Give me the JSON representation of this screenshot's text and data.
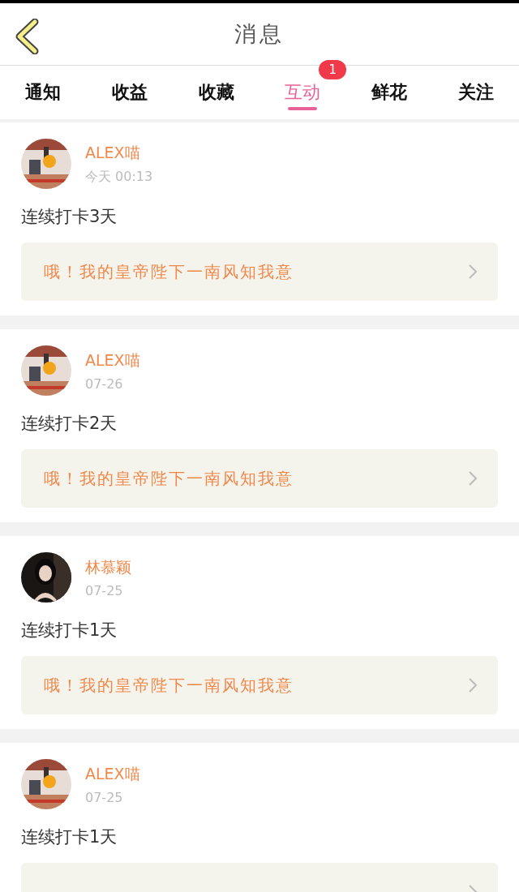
{
  "header": {
    "title": "消息"
  },
  "tabs": [
    {
      "label": "通知",
      "selected": false
    },
    {
      "label": "收益",
      "selected": false
    },
    {
      "label": "收藏",
      "selected": false
    },
    {
      "label": "互动",
      "selected": true,
      "badge": "1"
    },
    {
      "label": "鲜花",
      "selected": false
    },
    {
      "label": "关注",
      "selected": false
    }
  ],
  "messages": [
    {
      "name": "ALEX喵",
      "time": "今天 00:13",
      "text": "连续打卡3天",
      "quote": "哦！我的皇帝陛下一南风知我意"
    },
    {
      "name": "ALEX喵",
      "time": "07-26",
      "text": "连续打卡2天",
      "quote": "哦！我的皇帝陛下一南风知我意"
    },
    {
      "name": "林慕颖",
      "time": "07-25",
      "text": "连续打卡1天",
      "quote": "哦！我的皇帝陛下一南风知我意"
    },
    {
      "name": "ALEX喵",
      "time": "07-25",
      "text": "连续打卡1天"
    }
  ]
}
